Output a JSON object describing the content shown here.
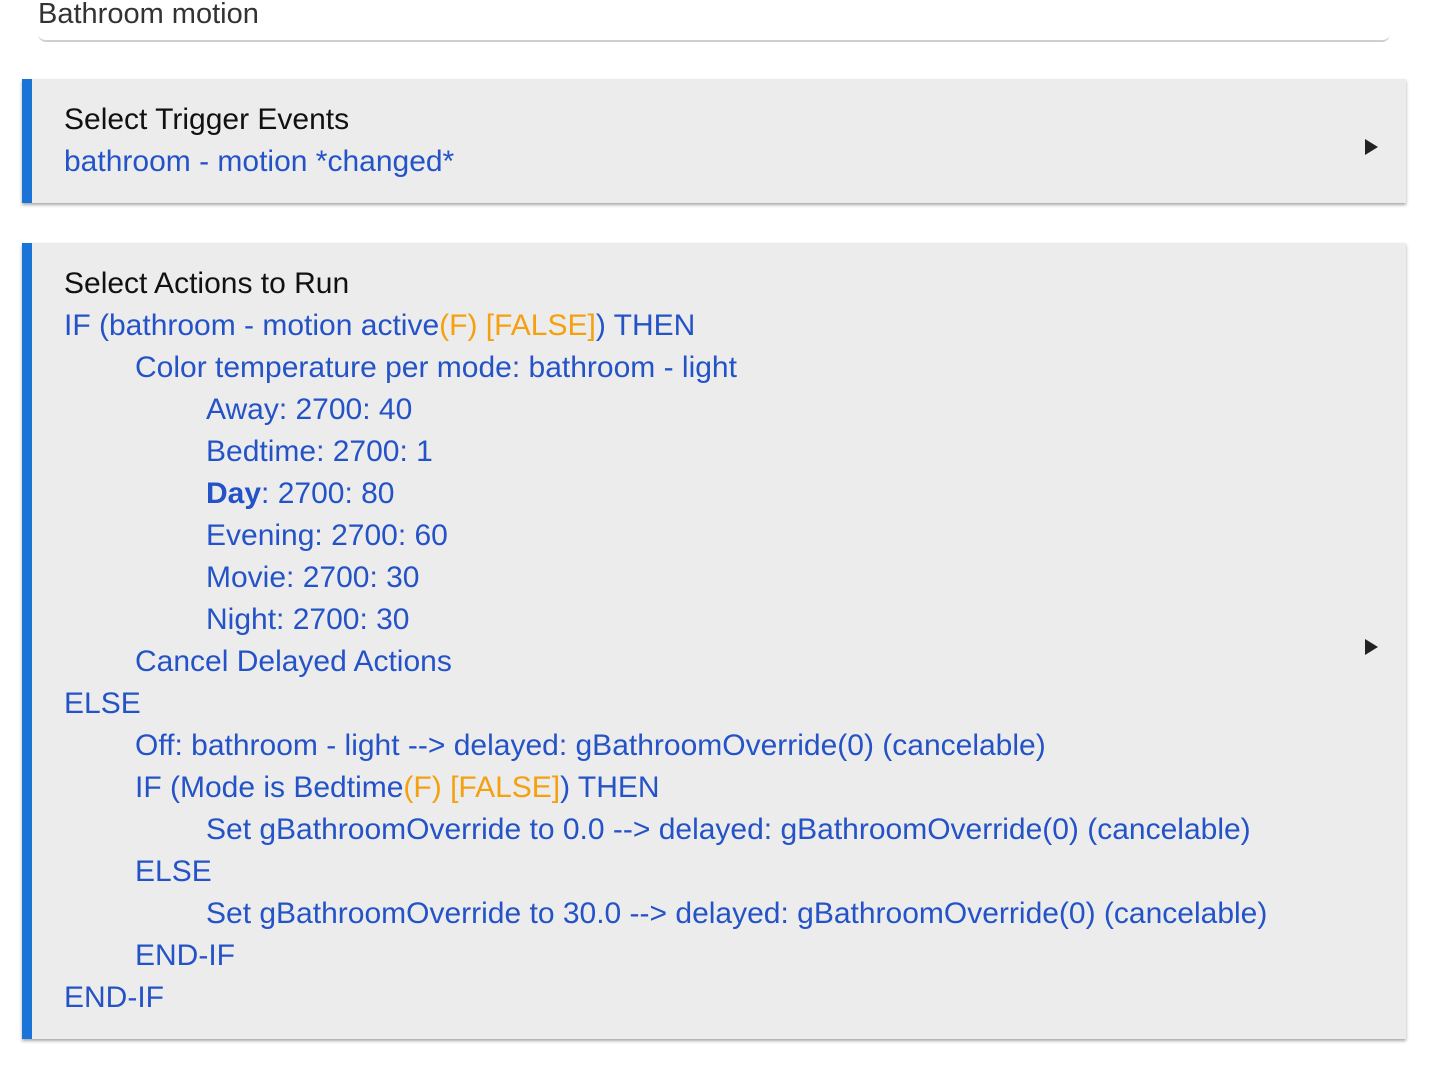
{
  "rule_name": {
    "value": "Bathroom motion"
  },
  "trigger": {
    "title": "Select Trigger Events",
    "summary": "bathroom - motion *changed*"
  },
  "actions": {
    "title": "Select Actions to Run",
    "if1": {
      "prefix": "IF (bathroom - motion active",
      "flag": "(F) [FALSE]",
      "suffix": ") THEN"
    },
    "color_temp": "Color temperature per mode: bathroom - light",
    "modes": [
      {
        "mode": "Away",
        "rest": ": 2700: 40"
      },
      {
        "mode": "Bedtime",
        "rest": ": 2700: 1"
      },
      {
        "mode": "Day",
        "rest": ": 2700: 80"
      },
      {
        "mode": "Evening",
        "rest": ": 2700: 60"
      },
      {
        "mode": "Movie",
        "rest": ": 2700: 30"
      },
      {
        "mode": "Night",
        "rest": ": 2700: 30"
      }
    ],
    "cancel": "Cancel Delayed Actions",
    "else1": "ELSE",
    "off": "Off: bathroom - light --> delayed: gBathroomOverride(0) (cancelable)",
    "if2": {
      "prefix": "IF (Mode is Bedtime",
      "flag": "(F) [FALSE]",
      "suffix": ") THEN"
    },
    "set_0": "Set gBathroomOverride to 0.0 --> delayed: gBathroomOverride(0) (cancelable)",
    "else2": "ELSE",
    "set_30": "Set gBathroomOverride to 30.0 --> delayed: gBathroomOverride(0) (cancelable)",
    "endif2": "END-IF",
    "endif1": "END-IF"
  },
  "colors": {
    "accent": "#1a73d6",
    "link_text": "#2453c8",
    "flag_text": "#f5a00f",
    "panel_bg": "#ececec"
  },
  "icons": {
    "expand": "triangle-right-icon"
  }
}
